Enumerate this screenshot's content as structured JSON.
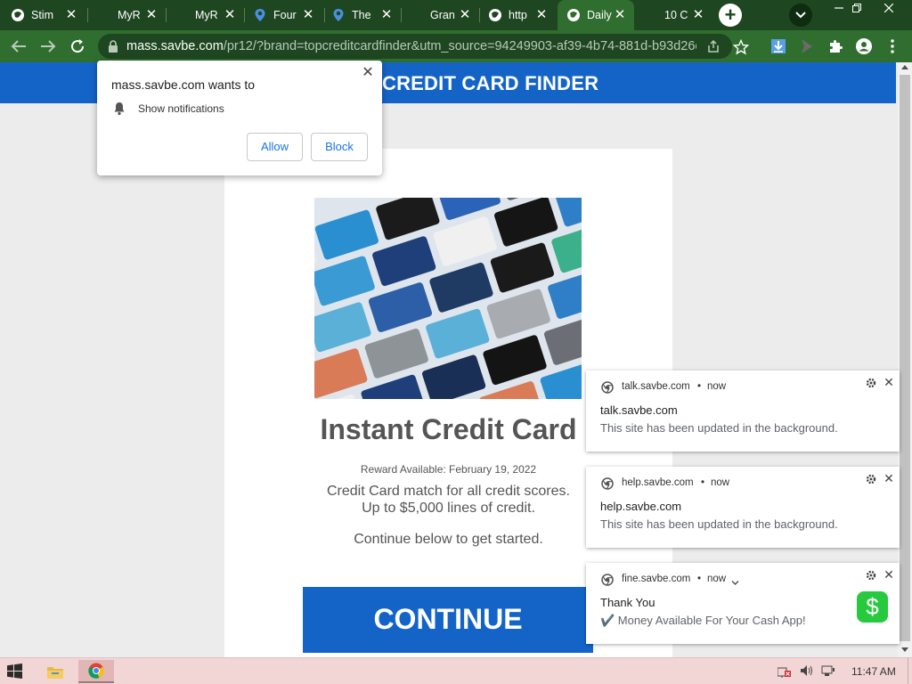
{
  "browser": {
    "tabs": [
      {
        "title": "Stim",
        "icon": "globe-icon",
        "active": false
      },
      {
        "title": "MyR",
        "icon": "none",
        "active": false
      },
      {
        "title": "MyR",
        "icon": "none",
        "active": false
      },
      {
        "title": "Four",
        "icon": "map-pin-icon",
        "active": false
      },
      {
        "title": "The",
        "icon": "map-pin-icon",
        "active": false
      },
      {
        "title": "Gran",
        "icon": "none",
        "active": false
      },
      {
        "title": "http",
        "icon": "globe-icon",
        "active": false
      },
      {
        "title": "Daily",
        "icon": "globe-icon",
        "active": true
      },
      {
        "title": "10 C",
        "icon": "none",
        "active": false
      }
    ],
    "new_tab_label": "+",
    "url_host": "mass.savbe.com",
    "url_rest": "/pr12/?brand=topcreditcardfinder&utm_source=94249903-af39-4b74-881d-b93d26e..."
  },
  "site": {
    "brand": "CREDIT CARD FINDER",
    "headline": "Instant Credit Card",
    "reward": "Reward Available: February 19, 2022",
    "desc_line1": "Credit Card match for all credit scores.",
    "desc_line2": "Up to $5,000 lines of credit.",
    "desc_line3": "Continue below to get started.",
    "continue_label": "CONTINUE"
  },
  "permission_prompt": {
    "title": "mass.savbe.com wants to",
    "item": "Show notifications",
    "allow_label": "Allow",
    "block_label": "Block",
    "close_label": "✕"
  },
  "notifications": [
    {
      "origin": "talk.savbe.com",
      "dot": "•",
      "time": "now",
      "title": "talk.savbe.com",
      "body": "This site has been updated in the background."
    },
    {
      "origin": "help.savbe.com",
      "dot": "•",
      "time": "now",
      "title": "help.savbe.com",
      "body": "This site has been updated in the background."
    },
    {
      "origin": "fine.savbe.com",
      "dot": "•",
      "time": "now",
      "title": "Thank You",
      "body": "✔️ Money Available For Your Cash App!",
      "app_badge": "$"
    }
  ],
  "taskbar": {
    "clock": "11:47 AM"
  },
  "colors": {
    "tab_strip": "#1e4620",
    "toolbar": "#2f6e2f",
    "site_blue": "#1464c8",
    "cashapp_green": "#27c93f",
    "taskbar": "#f2d6d6"
  }
}
